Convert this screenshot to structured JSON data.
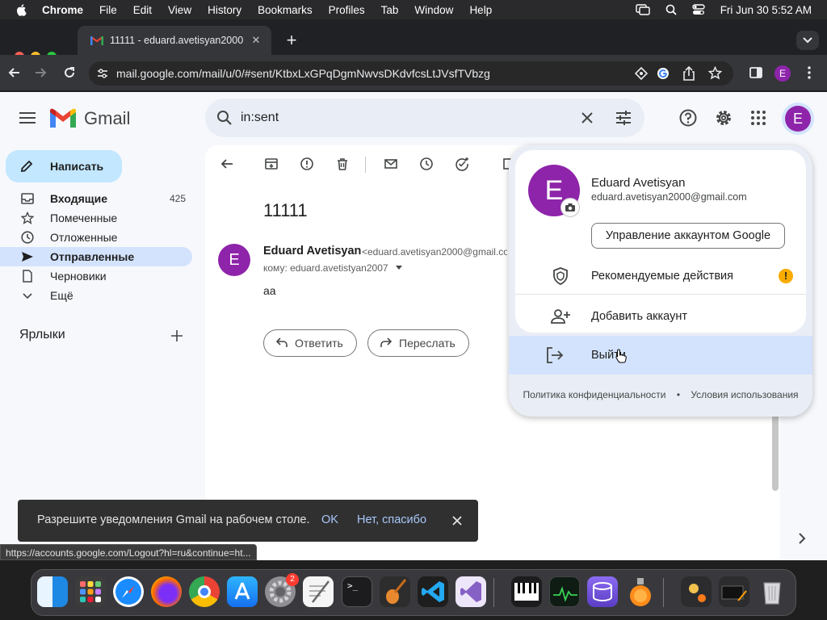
{
  "menubar": {
    "app": "Chrome",
    "items": [
      "File",
      "Edit",
      "View",
      "History",
      "Bookmarks",
      "Profiles",
      "Tab",
      "Window",
      "Help"
    ],
    "clock": "Fri Jun 30  5:52 AM"
  },
  "browser": {
    "tab_title": "11111 - eduard.avetisyan2000",
    "url": "mail.google.com/mail/u/0/#sent/KtbxLxGPqDgmNwvsDKdvfcsLtJVsfTVbzg",
    "profile_initial": "E"
  },
  "gmail": {
    "logo_text": "Gmail",
    "search_query": "in:sent",
    "compose_label": "Написать",
    "nav": [
      {
        "label": "Входящие",
        "count": "425",
        "icon": "inbox-icon"
      },
      {
        "label": "Помеченные",
        "count": "",
        "icon": "star-icon"
      },
      {
        "label": "Отложенные",
        "count": "",
        "icon": "clock-icon"
      },
      {
        "label": "Отправленные",
        "count": "",
        "icon": "send-icon"
      },
      {
        "label": "Черновики",
        "count": "",
        "icon": "draft-icon"
      },
      {
        "label": "Ещё",
        "count": "",
        "icon": "chevron-down-icon"
      }
    ],
    "labels_header": "Ярлыки",
    "message": {
      "subject": "11111",
      "avatar_initial": "E",
      "sender_name": "Eduard Avetisyan",
      "sender_email": "<eduard.avetisyan2000@gmail.co",
      "to": "кому: eduard.avetistyan2007",
      "body": "aa",
      "reply_label": "Ответить",
      "forward_label": "Переслать"
    }
  },
  "account_popup": {
    "avatar_initial": "E",
    "name": "Eduard Avetisyan",
    "email": "eduard.avetisyan2000@gmail.com",
    "manage_label": "Управление аккаунтом Google",
    "recommended_label": "Рекомендуемые действия",
    "add_account_label": "Добавить аккаунт",
    "signout_label": "Выйти",
    "privacy_label": "Политика конфиденциальности",
    "separator": "•",
    "terms_label": "Условия использования"
  },
  "snackbar": {
    "text": "Разрешите уведомления Gmail на рабочем столе.",
    "ok_label": "OK",
    "no_label": "Нет, спасибо"
  },
  "status_url": "https://accounts.google.com/Logout?hl=ru&continue=ht...",
  "dock": {
    "settings_badge": "2",
    "apps": [
      "finder-icon",
      "launchpad-icon",
      "safari-icon",
      "firefox-icon",
      "chrome-icon",
      "app-store-icon",
      "system-settings-icon",
      "textedit-icon",
      "terminal-icon",
      "garageband-icon",
      "vscode-icon",
      "visual-studio-icon",
      "piano-icon",
      "activity-monitor-icon",
      "stack-icon",
      "flask-icon",
      "preview-icon",
      "screenshot-icon",
      "trash-icon"
    ]
  },
  "colors": {
    "accent_blue": "#0b57d0",
    "compose_bg": "#c2e7ff",
    "active_nav": "#d3e3fd",
    "avatar_purple": "#8e24aa",
    "warning_yellow": "#f9ab00"
  }
}
